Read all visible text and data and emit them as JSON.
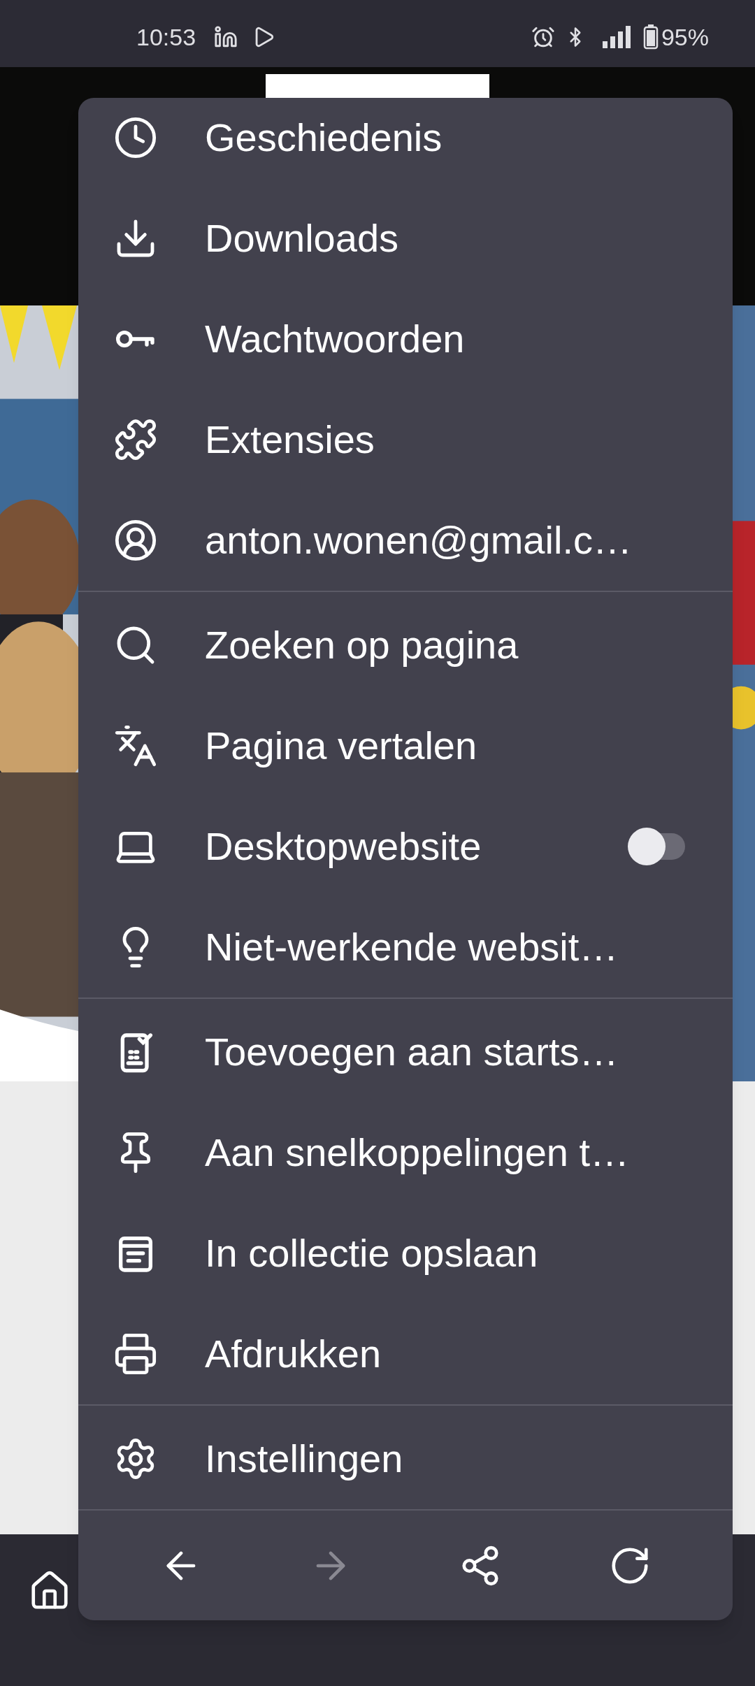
{
  "status_bar": {
    "time": "10:53",
    "battery": "95%"
  },
  "menu": {
    "sections": [
      {
        "items": [
          {
            "kind": "link",
            "label": "Geschiedenis"
          },
          {
            "kind": "link",
            "label": "Downloads"
          },
          {
            "kind": "link",
            "label": "Wachtwoorden"
          },
          {
            "kind": "link",
            "label": "Extensies"
          },
          {
            "kind": "link",
            "label": "anton.wonen@gmail.c…"
          }
        ]
      },
      {
        "items": [
          {
            "kind": "link",
            "label": "Zoeken op pagina"
          },
          {
            "kind": "link",
            "label": "Pagina vertalen"
          },
          {
            "kind": "toggle",
            "label": "Desktopwebsite",
            "on": false
          },
          {
            "kind": "link",
            "label": "Niet-werkende websit…"
          }
        ]
      },
      {
        "items": [
          {
            "kind": "link",
            "label": "Toevoegen aan starts…"
          },
          {
            "kind": "link",
            "label": "Aan snelkoppelingen t…"
          },
          {
            "kind": "link",
            "label": "In collectie opslaan"
          },
          {
            "kind": "link",
            "label": "Afdrukken"
          }
        ]
      },
      {
        "items": [
          {
            "kind": "link",
            "label": "Instellingen"
          }
        ]
      }
    ],
    "nav_buttons": [
      {
        "kind": "back",
        "disabled": false
      },
      {
        "kind": "forward",
        "disabled": true
      },
      {
        "kind": "share",
        "disabled": false
      },
      {
        "kind": "reload",
        "disabled": false
      }
    ]
  }
}
